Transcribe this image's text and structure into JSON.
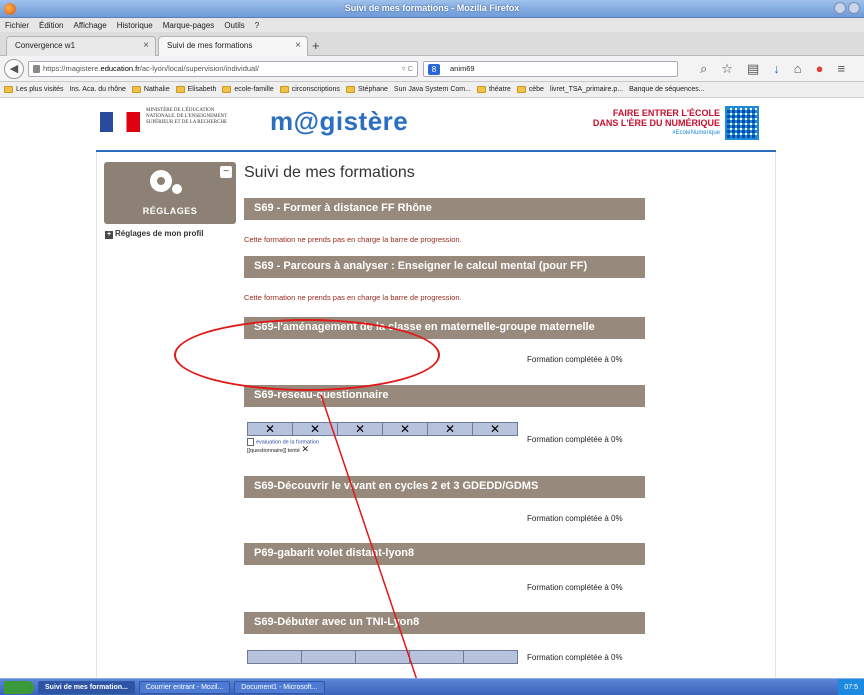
{
  "window": {
    "title": "Suivi de mes formations - Mozilla Firefox"
  },
  "menu": [
    "Fichier",
    "Édition",
    "Affichage",
    "Historique",
    "Marque-pages",
    "Outils",
    "?"
  ],
  "tabs": [
    {
      "label": "Convergence w1"
    },
    {
      "label": "Suivi de mes formations"
    }
  ],
  "nav": {
    "url_prefix": "https://magistere.",
    "url_host": "education.fr",
    "url_path": "/ac-lyon/local/supervision/individual/",
    "search_value": "anim69"
  },
  "bookmarks": [
    "Les plus visités",
    "Ins. Aca. du rhône",
    "Nathalie",
    "Elisabeth",
    "ecole-famille",
    "circonscriptions",
    "Stéphane",
    "Sun Java System Com...",
    "théatre",
    "cèbe",
    "livret_TSA_primaire.p...",
    "Banque de séquences..."
  ],
  "header": {
    "ministry": "MINISTÈRE DE L'ÉDUCATION NATIONALE, DE L'ENSEIGNEMENT SUPÉRIEUR ET DE LA RECHERCHE",
    "brand": "m@gistère",
    "slogan_1": "FAIRE ENTRER L'ÉCOLE",
    "slogan_2": "DANS L'ÈRE DU NUMÉRIQUE",
    "hashtag": "#EcoleNumerique"
  },
  "sidebar": {
    "settings_label": "RÉGLAGES",
    "profile_link": "Réglages de mon profil"
  },
  "page_title": "Suivi de mes formations",
  "courses": [
    {
      "title": "S69 - Former à distance FF Rhône",
      "note": "Cette formation ne prends pas en charge la barre de progression."
    },
    {
      "title": "S69 - Parcours à analyser : Enseigner le calcul mental (pour FF)",
      "note": "Cette formation ne prends pas en charge la barre de progression."
    },
    {
      "title": "S69-l'aménagement de la classe en maternelle-groupe maternelle",
      "completion": "Formation complétée à 0%"
    },
    {
      "title": "S69-reseau-questionnaire",
      "completion": "Formation complétée à 0%",
      "activity_link": "évaluation de la formation",
      "activity_status": "[[questionnaire]] tenté"
    },
    {
      "title": "S69-Découvrir le vivant en cycles 2 et 3 GDEDD/GDMS",
      "completion": "Formation complétée à 0%"
    },
    {
      "title": "P69-gabarit volet distant-lyon8",
      "completion": "Formation complétée à 0%"
    },
    {
      "title": "S69-Débuter avec un TNI-Lyon8",
      "completion": "Formation complétée à 0%"
    }
  ],
  "taskbar": {
    "items": [
      "Suivi de mes formation...",
      "Courrier entrant - Mozil...",
      "Document1 - Microsoft..."
    ],
    "clock": "07:5"
  }
}
